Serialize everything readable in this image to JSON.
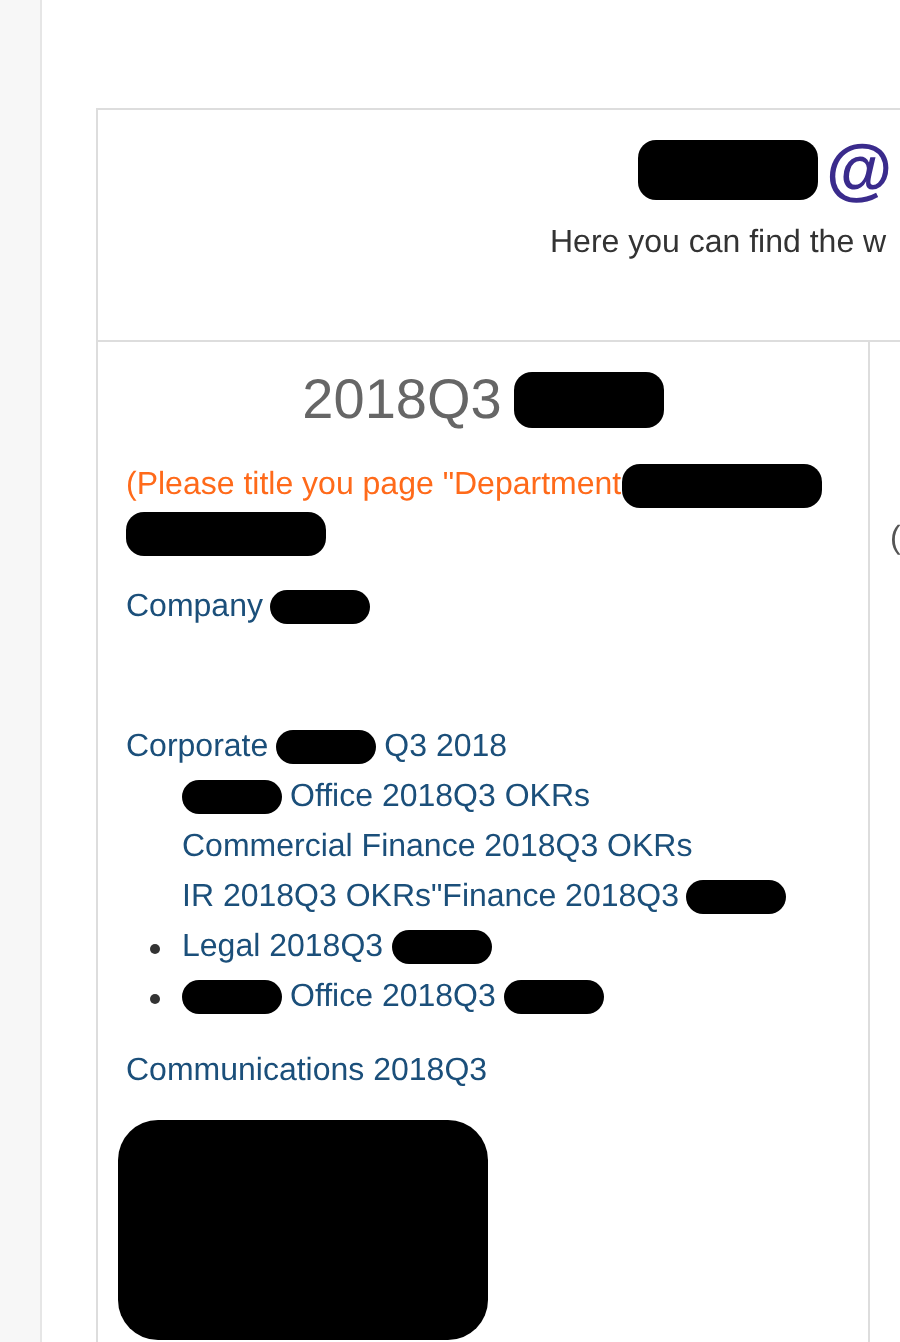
{
  "header": {
    "title_parts": [
      {
        "kind": "redacted"
      },
      {
        "kind": "text",
        "text": "@"
      }
    ],
    "subtitle": "Here you can find the w"
  },
  "left_column": {
    "heading": [
      {
        "kind": "text",
        "text": "2018Q3"
      },
      {
        "kind": "redacted"
      }
    ],
    "notice": [
      {
        "kind": "text",
        "text": "(Please title you page \"Department"
      },
      {
        "kind": "redacted"
      },
      {
        "kind": "break"
      },
      {
        "kind": "redacted"
      }
    ],
    "sections": [
      {
        "parts": [
          {
            "kind": "text",
            "text": "Company"
          },
          {
            "kind": "redacted"
          }
        ]
      },
      {
        "parts": [
          {
            "kind": "text",
            "text": "Corporate"
          },
          {
            "kind": "redacted"
          },
          {
            "kind": "text",
            "text": "Q3 2018"
          }
        ],
        "children": [
          {
            "bullet": false,
            "parts": [
              {
                "kind": "redacted"
              },
              {
                "kind": "text",
                "text": "Office 2018Q3 OKRs"
              }
            ]
          },
          {
            "bullet": false,
            "parts": [
              {
                "kind": "text",
                "text": "Commercial Finance 2018Q3 OKRs"
              }
            ]
          },
          {
            "bullet": false,
            "parts": [
              {
                "kind": "text",
                "text": "IR 2018Q3 OKRs\"Finance 2018Q3"
              },
              {
                "kind": "redacted"
              }
            ]
          },
          {
            "bullet": true,
            "parts": [
              {
                "kind": "text",
                "text": "Legal 2018Q3"
              },
              {
                "kind": "redacted"
              }
            ]
          },
          {
            "bullet": true,
            "parts": [
              {
                "kind": "redacted"
              },
              {
                "kind": "text",
                "text": "Office 2018Q3"
              },
              {
                "kind": "redacted"
              }
            ]
          }
        ]
      },
      {
        "parts": [
          {
            "kind": "text",
            "text": "Communications 2018Q3"
          }
        ]
      },
      {
        "parts": [
          {
            "kind": "redacted_block"
          }
        ]
      }
    ]
  },
  "right_column": {
    "text": "("
  }
}
